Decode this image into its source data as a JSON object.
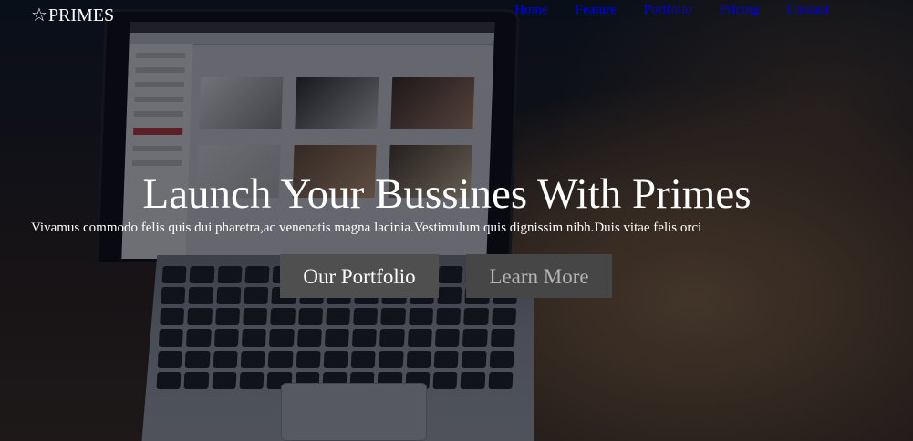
{
  "brand": {
    "logo_text": "PRIMES",
    "logo_icon": "star-icon"
  },
  "nav": {
    "items": [
      {
        "label": "Home"
      },
      {
        "label": "Feature"
      },
      {
        "label": "Portfolio"
      },
      {
        "label": "Pricing"
      },
      {
        "label": "Contact"
      }
    ]
  },
  "hero": {
    "title": "Launch Your Bussines With Primes",
    "subtitle": "Vivamus commodo felis quis dui pharetra,ac venenatis magna lacinia.Vestimulum quis dignissim nibh.Duis vitae felis orci",
    "primary_button": "Our Portfolio",
    "secondary_button": "Learn More"
  },
  "colors": {
    "nav_link": "#0000ee",
    "button_primary_bg": "#4f4f50",
    "button_secondary_bg": "#464647",
    "text": "#ffffff"
  }
}
